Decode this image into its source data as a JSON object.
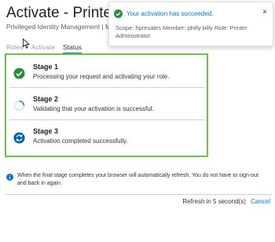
{
  "panel": {
    "title": "Activate - Printer Ac",
    "subtitle": "Privileged Identity Management | Microso"
  },
  "tabs": [
    {
      "label": "Roles"
    },
    {
      "label": "Activate"
    },
    {
      "label": "Status",
      "active": true
    }
  ],
  "stages": [
    {
      "title": "Stage 1",
      "description": "Processing your request and activating your role.",
      "icon": "check-circle-icon",
      "color": "#2e8b3a"
    },
    {
      "title": "Stage 2",
      "description": "Validating that your activation is successful.",
      "icon": "spinner-icon",
      "color": "#0078d4"
    },
    {
      "title": "Stage 3",
      "description": "Activation completed successfully.",
      "icon": "refresh-circle-icon",
      "color": "#0063b1"
    }
  ],
  "info": {
    "icon": "info-icon",
    "text": "When the final stage completes your browser will automatically refresh. You do not have to sign-out and back in again."
  },
  "footer": {
    "refresh_text": "Refresh in 5 second(s)",
    "cancel_label": "Cancel"
  },
  "toast": {
    "title": "Your activation has succeeded.",
    "body": "Scope: hpresales Member: philly billy Role: Printer Administrator",
    "close_glyph": "×",
    "icon": "success-check-icon"
  },
  "colors": {
    "highlight_border": "#6cc24a",
    "accent": "#0078d4",
    "success": "#2e8b3a"
  }
}
